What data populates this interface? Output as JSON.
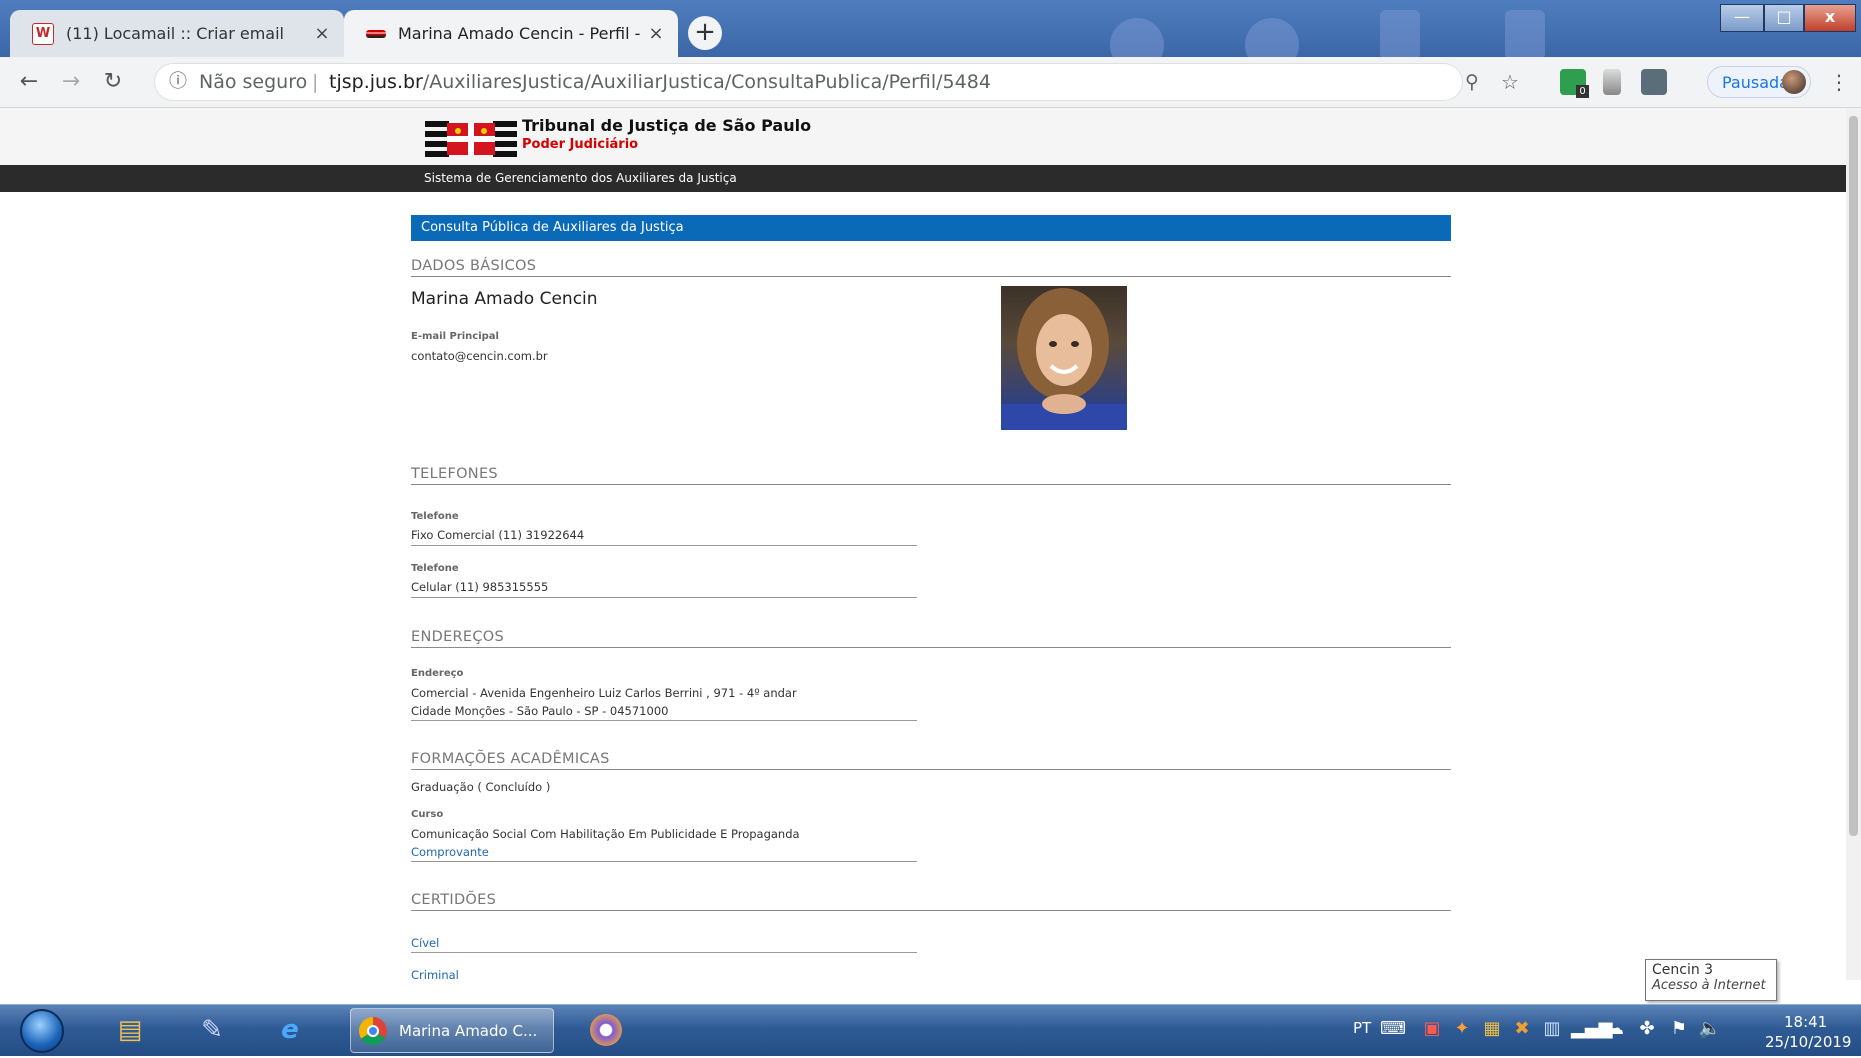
{
  "browser": {
    "tabs": [
      {
        "favicon": "W",
        "title": "(11) Locamail :: Criar email",
        "close": "×"
      },
      {
        "favicon": "",
        "title": "Marina Amado Cencin - Perfil - A",
        "close": "×"
      }
    ],
    "new_tab": "+",
    "window_controls": {
      "minimize": "—",
      "maximize": "□",
      "close": "x"
    },
    "address": {
      "security": "Não seguro",
      "separator": "|",
      "host": "tjsp.jus.br",
      "path": "/AuxiliaresJustica/AuxiliarJustica/ConsultaPublica/Perfil/5484"
    },
    "profile_label": "Pausada",
    "ext_badge": "0"
  },
  "page": {
    "org_name": "Tribunal de Justiça de São Paulo",
    "org_sub": "Poder Judiciário",
    "system_title": "Sistema de Gerenciamento dos Auxiliares da Justiça",
    "panel_title": "Consulta Pública de Auxiliares da Justiça",
    "sections": {
      "basic": "DADOS BÁSICOS",
      "phones": "TELEFONES",
      "addresses": "ENDEREÇOS",
      "education": "FORMAÇÕES ACADÊMICAS",
      "certificates": "CERTIDÕES"
    },
    "person_name": "Marina Amado Cencin",
    "email_label": "E-mail Principal",
    "email_value": "contato@cencin.com.br",
    "phones": [
      {
        "label": "Telefone",
        "value": "Fixo Comercial (11) 31922644"
      },
      {
        "label": "Telefone",
        "value": "Celular (11) 985315555"
      }
    ],
    "address": {
      "label": "Endereço",
      "line1": "Comercial - Avenida Engenheiro Luiz Carlos Berrini , 971 - 4º andar",
      "line2": "Cidade Monções - São Paulo - SP - 04571000"
    },
    "education": {
      "degree": "Graduação ( Concluído )",
      "course_label": "Curso",
      "course_value": "Comunicação Social Com Habilitação Em Publicidade E Propaganda",
      "proof_link": "Comprovante"
    },
    "certificates": [
      "Cível",
      "Criminal"
    ]
  },
  "tooltip": {
    "title": "Cencin 3",
    "subtitle": "Acesso à Internet"
  },
  "taskbar": {
    "active_task": "Marina Amado C...",
    "language": "PT",
    "time": "18:41",
    "date": "25/10/2019"
  }
}
